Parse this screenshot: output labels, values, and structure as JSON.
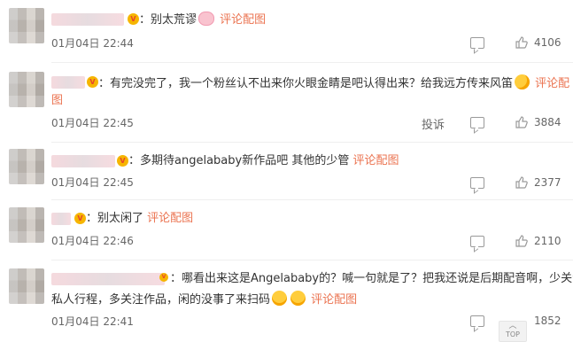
{
  "comments": [
    {
      "text": "：别太荒谬",
      "emoji": "pig-face-icon",
      "link": "评论配图",
      "time": "01月04日 22:44",
      "likes": "4106"
    },
    {
      "text_line1": "：有完没完了，我一个粉丝认不出来你火眼金睛是吧认得出来？给我远方传来风笛",
      "link_line1": "评论配",
      "link_line2": "图",
      "emoji": "kiss-face-icon",
      "time": "01月04日 22:45",
      "report": "投诉",
      "likes": "3884"
    },
    {
      "text": "：多期待angelababy新作品吧 其他的少管",
      "link": "评论配图",
      "time": "01月04日 22:45",
      "likes": "2377"
    },
    {
      "text": "：别太闲了",
      "link": "评论配图",
      "time": "01月04日 22:46",
      "likes": "2110"
    },
    {
      "text_line1": "：哪看出来这是Angelababy的？喊一句就是了？把我还说是后期配音啊，少关注",
      "text_line2": "私人行程，多关注作品，闲的没事了来扫码",
      "emoji": "wow-face-icon",
      "link": "评论配图",
      "time": "01月04日 22:41",
      "likes": "1852"
    }
  ],
  "scroll_top_label": "TOP",
  "colors": {
    "link": "#eb7350",
    "text": "#333333",
    "meta": "#666666"
  }
}
